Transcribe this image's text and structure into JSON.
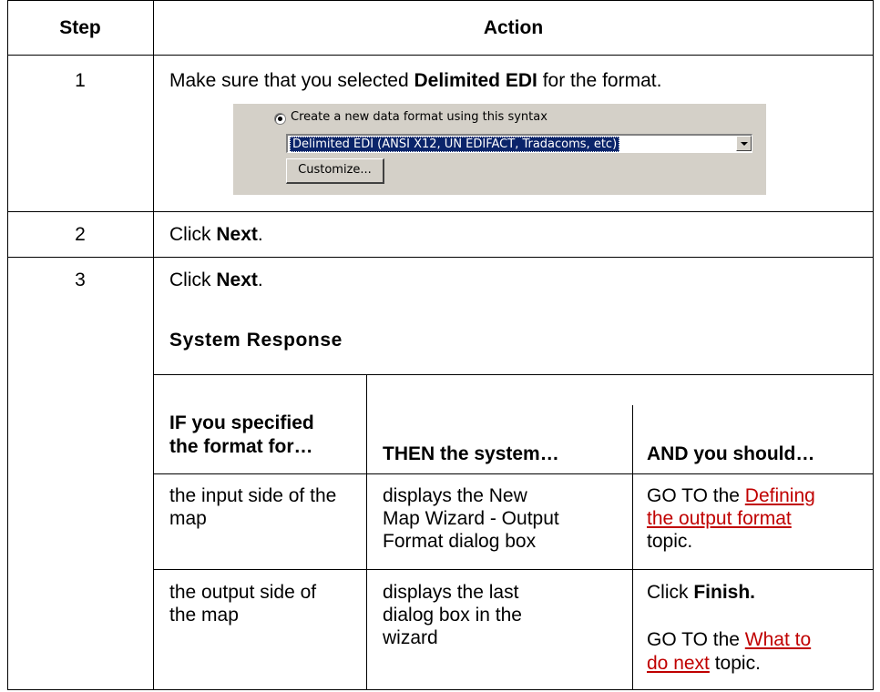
{
  "headers": {
    "step": "Step",
    "action": "Action"
  },
  "rows": [
    {
      "step": "1",
      "text_pre": "Make sure that you selected ",
      "text_bold": "Delimited EDI",
      "text_post": " for the format."
    },
    {
      "step": "2",
      "text_pre": "Click ",
      "text_bold": "Next",
      "text_post": "."
    },
    {
      "step": "3",
      "text_pre": "Click ",
      "text_bold": "Next",
      "text_post": "."
    }
  ],
  "dialog": {
    "radio_label": "Create a new data format using this syntax",
    "combo_value": "Delimited EDI (ANSI X12, UN EDIFACT, Tradacoms, etc)",
    "customize_label": "Customize..."
  },
  "system_response": {
    "title": "System Response",
    "headers": {
      "if_line1": "IF you specified",
      "if_line2": "the format for…",
      "then": "THEN the system…",
      "and": "AND you should…"
    },
    "rows": [
      {
        "if_lines": [
          "the input side of the",
          "map"
        ],
        "then_lines": [
          "displays the New",
          "Map Wizard - Output",
          "Format dialog box"
        ],
        "and": {
          "pre": "GO TO the ",
          "link_line1": "Defining",
          "link_line2": "the output format",
          "post": "topic."
        }
      },
      {
        "if_lines": [
          "the output side of",
          "the map"
        ],
        "then_lines": [
          "displays the last",
          "dialog box in the",
          "wizard"
        ],
        "and": {
          "click_pre": "Click ",
          "click_bold": "Finish.",
          "pre": "GO TO the ",
          "link_line1": "What to",
          "link_line2": "do next",
          "post": " topic."
        }
      }
    ]
  }
}
